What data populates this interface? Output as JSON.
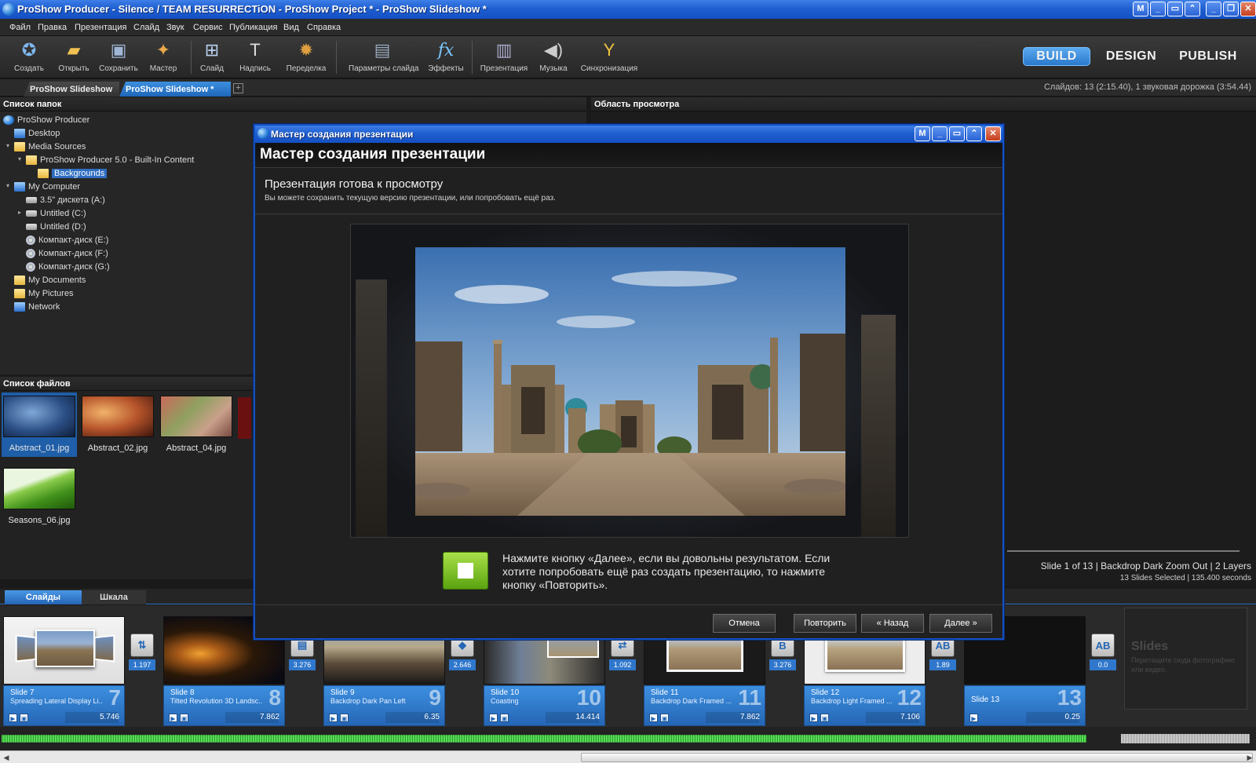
{
  "window": {
    "title": "ProShow Producer - Silence / TEAM RESURRECTiON - ProShow Project * - ProShow Slideshow *"
  },
  "menu": [
    "Файл",
    "Правка",
    "Презентация",
    "Слайд",
    "Звук",
    "Сервис",
    "Публикация",
    "Вид",
    "Справка"
  ],
  "toolbar": {
    "tools": [
      {
        "label": "Создать",
        "icon": "create-icon"
      },
      {
        "label": "Открыть",
        "icon": "open-folder-icon"
      },
      {
        "label": "Сохранить",
        "icon": "save-disk-icon"
      },
      {
        "label": "Мастер",
        "icon": "wizard-icon"
      },
      {
        "label": "Слайд",
        "icon": "add-slide-icon"
      },
      {
        "label": "Надпись",
        "icon": "caption-icon"
      },
      {
        "label": "Переделка",
        "icon": "remix-icon"
      },
      {
        "label": "Параметры слайда",
        "icon": "slide-options-icon"
      },
      {
        "label": "Эффекты",
        "icon": "fx-icon"
      },
      {
        "label": "Презентация",
        "icon": "show-options-icon"
      },
      {
        "label": "Музыка",
        "icon": "music-speaker-icon"
      },
      {
        "label": "Синхронизация",
        "icon": "sync-icon"
      }
    ],
    "modes": {
      "build": "BUILD",
      "design": "DESIGN",
      "publish": "PUBLISH"
    }
  },
  "tabs": {
    "items": [
      "ProShow Slideshow",
      "ProShow Slideshow *"
    ],
    "status": "Слайдов: 13 (2:15.40), 1 звуковая дорожка (3:54.44)"
  },
  "folders": {
    "header": "Список папок",
    "items": [
      {
        "label": "ProShow Producer",
        "icon": "app"
      },
      {
        "label": "Desktop",
        "icon": "comp"
      },
      {
        "label": "Media Sources",
        "icon": "folder"
      },
      {
        "label": "ProShow Producer 5.0 - Built-In Content",
        "icon": "folder"
      },
      {
        "label": "Backgrounds",
        "icon": "folder"
      },
      {
        "label": "My Computer",
        "icon": "comp"
      },
      {
        "label": "3.5\" дискета (A:)",
        "icon": "drive"
      },
      {
        "label": "Untitled (C:)",
        "icon": "drive"
      },
      {
        "label": "Untitled (D:)",
        "icon": "drive"
      },
      {
        "label": "Компакт-диск (E:)",
        "icon": "cd"
      },
      {
        "label": "Компакт-диск (F:)",
        "icon": "cd"
      },
      {
        "label": "Компакт-диск (G:)",
        "icon": "cd"
      },
      {
        "label": "My Documents",
        "icon": "folder"
      },
      {
        "label": "My Pictures",
        "icon": "folder"
      },
      {
        "label": "Network",
        "icon": "comp"
      }
    ],
    "selected_label": "Backgrounds"
  },
  "files": {
    "header": "Список файлов",
    "items": [
      "Abstract_01.jpg",
      "Abstract_02.jpg",
      "Abstract_04.jpg",
      "Seasons_06.jpg"
    ],
    "selected_file": "Abstract_01.jpg"
  },
  "preview": {
    "header": "Область просмотра",
    "slide_info": "Slide 1 of 13  |  Backdrop Dark Zoom Out  |  2 Layers",
    "slide_info_sub": "13 Slides Selected  |  135.400 seconds"
  },
  "bottom_tabs": {
    "slides": "Слайды",
    "timeline": "Шкала"
  },
  "slides": [
    {
      "name": "Slide 7",
      "effect": "Spreading Lateral Display Li...",
      "num": "7",
      "duration": "5.746"
    },
    {
      "name": "Slide 8",
      "effect": "Tilted Revolution 3D Landsc...",
      "num": "8",
      "duration": "7.862"
    },
    {
      "name": "Slide 9",
      "effect": "Backdrop Dark Pan Left",
      "num": "9",
      "duration": "6.35"
    },
    {
      "name": "Slide 10",
      "effect": "Coasting",
      "num": "10",
      "duration": "14.414"
    },
    {
      "name": "Slide 11",
      "effect": "Backdrop Dark Framed ...",
      "num": "11",
      "duration": "7.862"
    },
    {
      "name": "Slide 12",
      "effect": "Backdrop Light Framed ...",
      "num": "12",
      "duration": "7.106"
    },
    {
      "name": "Slide 13",
      "effect": "",
      "num": "13",
      "duration": "0.25"
    }
  ],
  "transitions": [
    "1.197",
    "3.276",
    "2.646",
    "1.092",
    "3.276",
    "1.89",
    "0.0"
  ],
  "drop_hint": {
    "title": "Slides",
    "text": "Перетащите сюда фотографию или видео."
  },
  "wizard": {
    "window_title": "Мастер создания презентации",
    "header": "Мастер создания презентации",
    "subtitle": "Презентация готова к просмотру",
    "description": "Вы можете сохранить текущую версию презентации, или попробовать ещё раз.",
    "hint": "Нажмите кнопку «Далее», если вы довольны результатом. Если хотите попробовать ещё раз создать презентацию, то нажмите кнопку «Повторить».",
    "buttons": {
      "cancel": "Отмена",
      "retry": "Повторить",
      "back": "« Назад",
      "next": "Далее »"
    }
  }
}
